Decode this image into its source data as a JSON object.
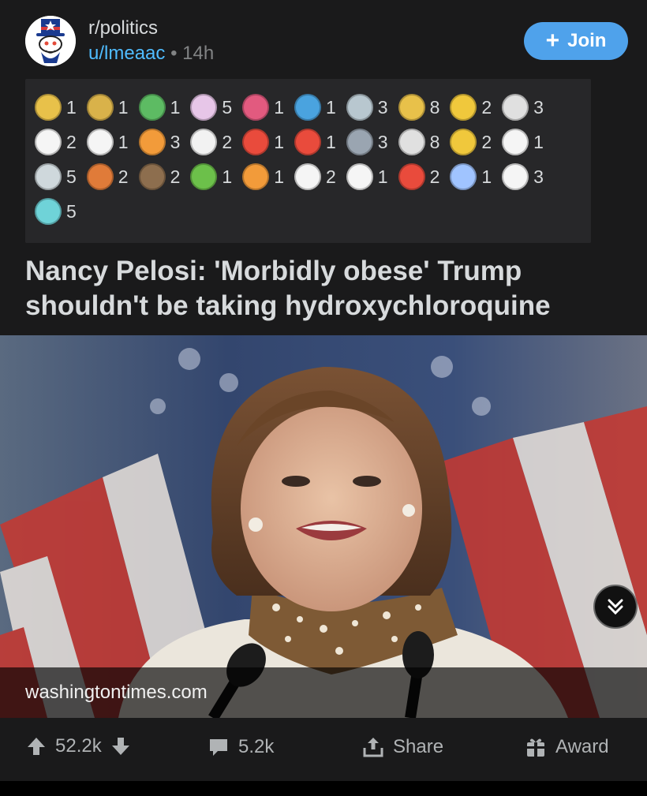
{
  "post": {
    "subreddit": "r/politics",
    "author": "u/lmeaac",
    "separator": "•",
    "age": "14h",
    "join_label": "Join",
    "join_icon": "plus-icon",
    "title": "Nancy Pelosi: 'Morbidly obese' Trump shouldn't be taking hydroxychloroquine",
    "link_domain": "washingtontimes.com",
    "image_description_icon": "news-photo"
  },
  "awards": [
    {
      "icon": "gold-award-icon",
      "count": "1",
      "color": "#e8c14a"
    },
    {
      "icon": "helpful-award-icon",
      "count": "1",
      "color": "#d9b24a"
    },
    {
      "icon": "frog-award-icon",
      "count": "1",
      "color": "#5dbb63"
    },
    {
      "icon": "unicorn-award-icon",
      "count": "5",
      "color": "#e7c6e8"
    },
    {
      "icon": "heart-award-icon",
      "count": "1",
      "color": "#e25a7f"
    },
    {
      "icon": "plus-one-award-icon",
      "count": "1",
      "color": "#4aa3df"
    },
    {
      "icon": "platinum-award-icon",
      "count": "3",
      "color": "#b8c7cf"
    },
    {
      "icon": "silver-star-award-icon",
      "count": "8",
      "color": "#e8c14a"
    },
    {
      "icon": "clap-award-icon",
      "count": "2",
      "color": "#f0c83c"
    },
    {
      "icon": "skeleton-award-icon",
      "count": "3",
      "color": "#e0e0e0"
    },
    {
      "icon": "snoo-award-icon",
      "count": "2",
      "color": "#f5f5f5"
    },
    {
      "icon": "hand-award-icon",
      "count": "1",
      "color": "#f5f5f5"
    },
    {
      "icon": "rocket-award-icon",
      "count": "3",
      "color": "#f29b3a"
    },
    {
      "icon": "goat-award-icon",
      "count": "2",
      "color": "#f2f2f2"
    },
    {
      "icon": "gift-award-icon",
      "count": "1",
      "color": "#e94b3c"
    },
    {
      "icon": "2020-award-icon",
      "count": "1",
      "color": "#e94b3c"
    },
    {
      "icon": "thinker-award-icon",
      "count": "3",
      "color": "#9aa5b1"
    },
    {
      "icon": "skull-award-icon",
      "count": "8",
      "color": "#e0e0e0"
    },
    {
      "icon": "sun-award-icon",
      "count": "2",
      "color": "#f0c83c"
    },
    {
      "icon": "press-f-award-icon",
      "count": "1",
      "color": "#f5f5f5"
    },
    {
      "icon": "silver-coin-award-icon",
      "count": "5",
      "color": "#cfd8dc"
    },
    {
      "icon": "monkey-award-icon",
      "count": "2",
      "color": "#e07b39"
    },
    {
      "icon": "monkey-face-award-icon",
      "count": "2",
      "color": "#8d6e4e"
    },
    {
      "icon": "snake-award-icon",
      "count": "1",
      "color": "#6cc04a"
    },
    {
      "icon": "fire-award-icon",
      "count": "1",
      "color": "#f29b3a"
    },
    {
      "icon": "snoo-face-award-icon",
      "count": "2",
      "color": "#f5f5f5"
    },
    {
      "icon": "snoo-dance-award-icon",
      "count": "1",
      "color": "#f5f5f5"
    },
    {
      "icon": "scream-award-icon",
      "count": "2",
      "color": "#e94b3c"
    },
    {
      "icon": "bandage-award-icon",
      "count": "1",
      "color": "#a0c4ff"
    },
    {
      "icon": "facepalm-award-icon",
      "count": "3",
      "color": "#f5f5f5"
    },
    {
      "icon": "space-award-icon",
      "count": "5",
      "color": "#6fd3d8"
    }
  ],
  "actions": {
    "upvote_icon": "upvote-arrow-icon",
    "score": "52.2k",
    "downvote_icon": "downvote-arrow-icon",
    "comment_icon": "comment-bubble-icon",
    "comments": "5.2k",
    "share_icon": "share-icon",
    "share_label": "Share",
    "award_icon": "award-gift-icon",
    "award_label": "Award"
  },
  "colors": {
    "card_bg": "#1a1a1b",
    "awards_bg": "#272729",
    "join_bg": "#4fa2eb",
    "username": "#4fbcff",
    "muted": "#818384"
  }
}
